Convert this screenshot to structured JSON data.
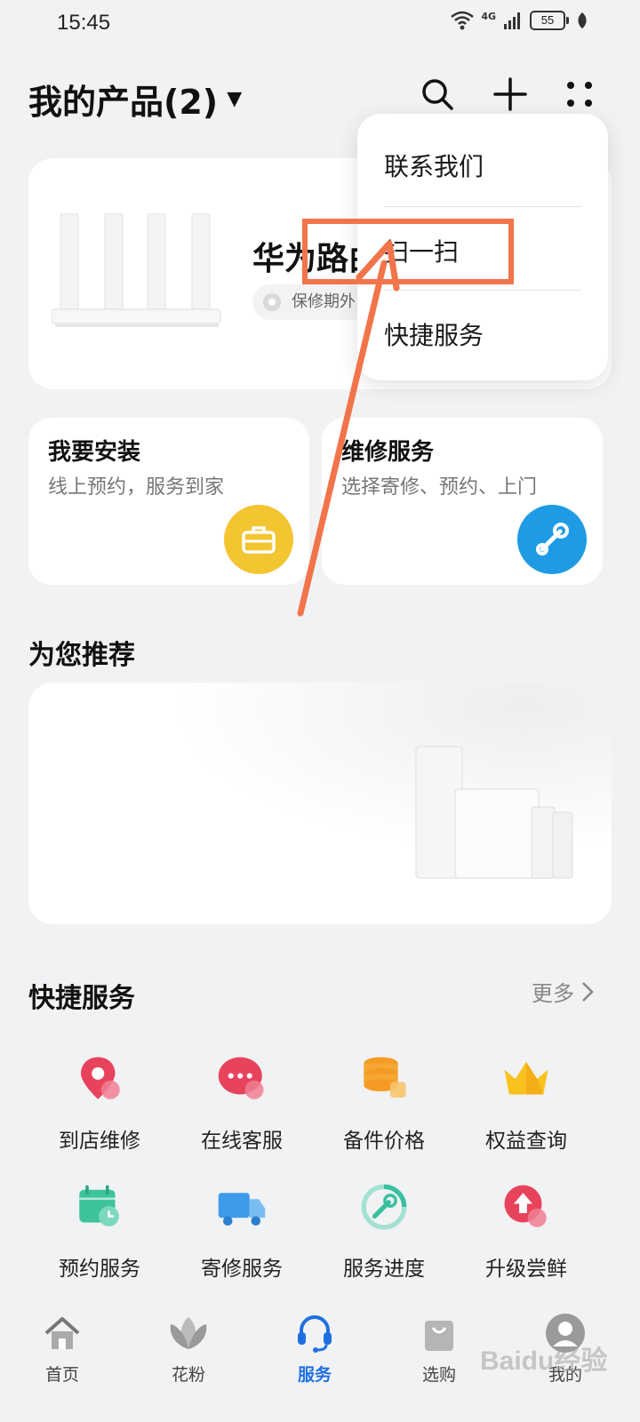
{
  "status_bar": {
    "time": "15:45",
    "network": "4G",
    "battery": "55"
  },
  "header": {
    "title": "我的产品(2)",
    "dropdown_icon": "triangle-down-icon",
    "actions": [
      "search-icon",
      "plus-icon",
      "grid-dots-icon"
    ]
  },
  "product_card": {
    "name": "华为路由",
    "warranty": "保修期外"
  },
  "service_cards": [
    {
      "title": "我要安装",
      "subtitle": "线上预约，服务到家",
      "icon": "toolbox-icon",
      "color": "#f2c531"
    },
    {
      "title": "维修服务",
      "subtitle": "选择寄修、预约、上门",
      "icon": "wrench-icon",
      "color": "#1e9be4"
    }
  ],
  "recommend": {
    "title": "为您推荐"
  },
  "quick_services": {
    "title": "快捷服务",
    "more": "更多",
    "items": [
      {
        "label": "到店维修",
        "icon": "location-pin-icon"
      },
      {
        "label": "在线客服",
        "icon": "chat-bubble-icon"
      },
      {
        "label": "备件价格",
        "icon": "coins-icon"
      },
      {
        "label": "权益查询",
        "icon": "crown-icon"
      },
      {
        "label": "预约服务",
        "icon": "calendar-clock-icon"
      },
      {
        "label": "寄修服务",
        "icon": "delivery-truck-icon"
      },
      {
        "label": "服务进度",
        "icon": "wrench-progress-icon"
      },
      {
        "label": "升级尝鲜",
        "icon": "upgrade-arrow-icon"
      }
    ]
  },
  "bottom_nav": [
    {
      "label": "首页",
      "icon": "home-icon",
      "active": false
    },
    {
      "label": "花粉",
      "icon": "flower-icon",
      "active": false
    },
    {
      "label": "服务",
      "icon": "headset-icon",
      "active": true
    },
    {
      "label": "选购",
      "icon": "shopping-bag-icon",
      "active": false
    },
    {
      "label": "我的",
      "icon": "avatar-icon",
      "active": false
    }
  ],
  "menu": {
    "items": [
      "联系我们",
      "扫一扫",
      "快捷服务"
    ],
    "highlighted": "扫一扫"
  },
  "watermark": "Baidu经验",
  "colors": {
    "accent_blue": "#1f6fe0",
    "annotation_orange": "#f2744a"
  }
}
